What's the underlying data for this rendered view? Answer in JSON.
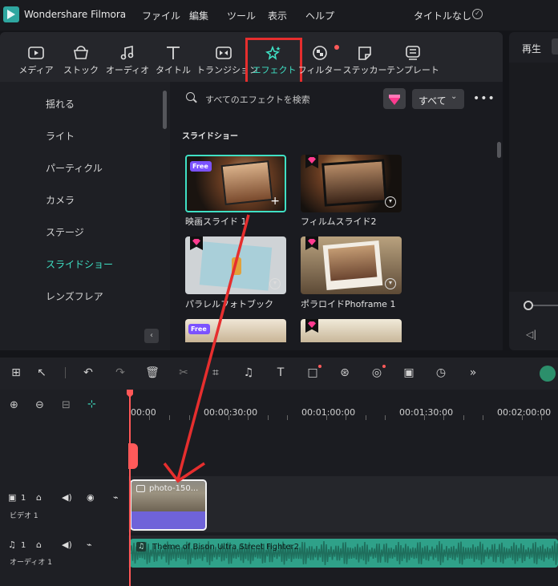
{
  "titlebar": {
    "app_name": "Wondershare Filmora",
    "menus": [
      "ファイル",
      "編集",
      "ツール",
      "表示",
      "ヘルプ"
    ],
    "project_name": "タイトルなし"
  },
  "toolbar": {
    "tabs": [
      "メディア",
      "ストック",
      "オーディオ",
      "タイトル",
      "トランジション",
      "エフェクト",
      "フィルター",
      "ステッカー",
      "テンプレート"
    ],
    "selected": "エフェクト"
  },
  "sidebar": {
    "items": [
      "揺れる",
      "ライト",
      "パーティクル",
      "カメラ",
      "ステージ",
      "スライドショー",
      "レンズフレア"
    ],
    "selected": "スライドショー"
  },
  "content": {
    "search_placeholder": "すべてのエフェクトを検索",
    "filter": "すべて",
    "section_title": "スライドショー",
    "effects": [
      {
        "label": "映画スライド 1",
        "badge": "Free"
      },
      {
        "label": "フィルムスライド2",
        "badge": "premium"
      },
      {
        "label": "パラレルフォトブック",
        "badge": "premium"
      },
      {
        "label": "ポラロイドPhoframe 1",
        "badge": "premium"
      },
      {
        "label": "",
        "badge": "Free"
      },
      {
        "label": "",
        "badge": "premium"
      }
    ]
  },
  "preview": {
    "label": "再生"
  },
  "timeline": {
    "ruler": [
      "00:00",
      "00:00:30:00",
      "00:01:00:00",
      "00:01:30:00",
      "00:02:00:00"
    ],
    "video_track": {
      "num": "1",
      "name": "ビデオ 1",
      "clip": "photo-150..."
    },
    "audio_track": {
      "num": "1",
      "name": "オーディオ 1",
      "clip": "Theme of Bison Ultra Street Fighter2"
    }
  },
  "colors": {
    "accent": "#3fe0c4",
    "highlight": "#e62e2e",
    "audio_clip": "#2fa189",
    "video_clip": "#6f63d9"
  }
}
